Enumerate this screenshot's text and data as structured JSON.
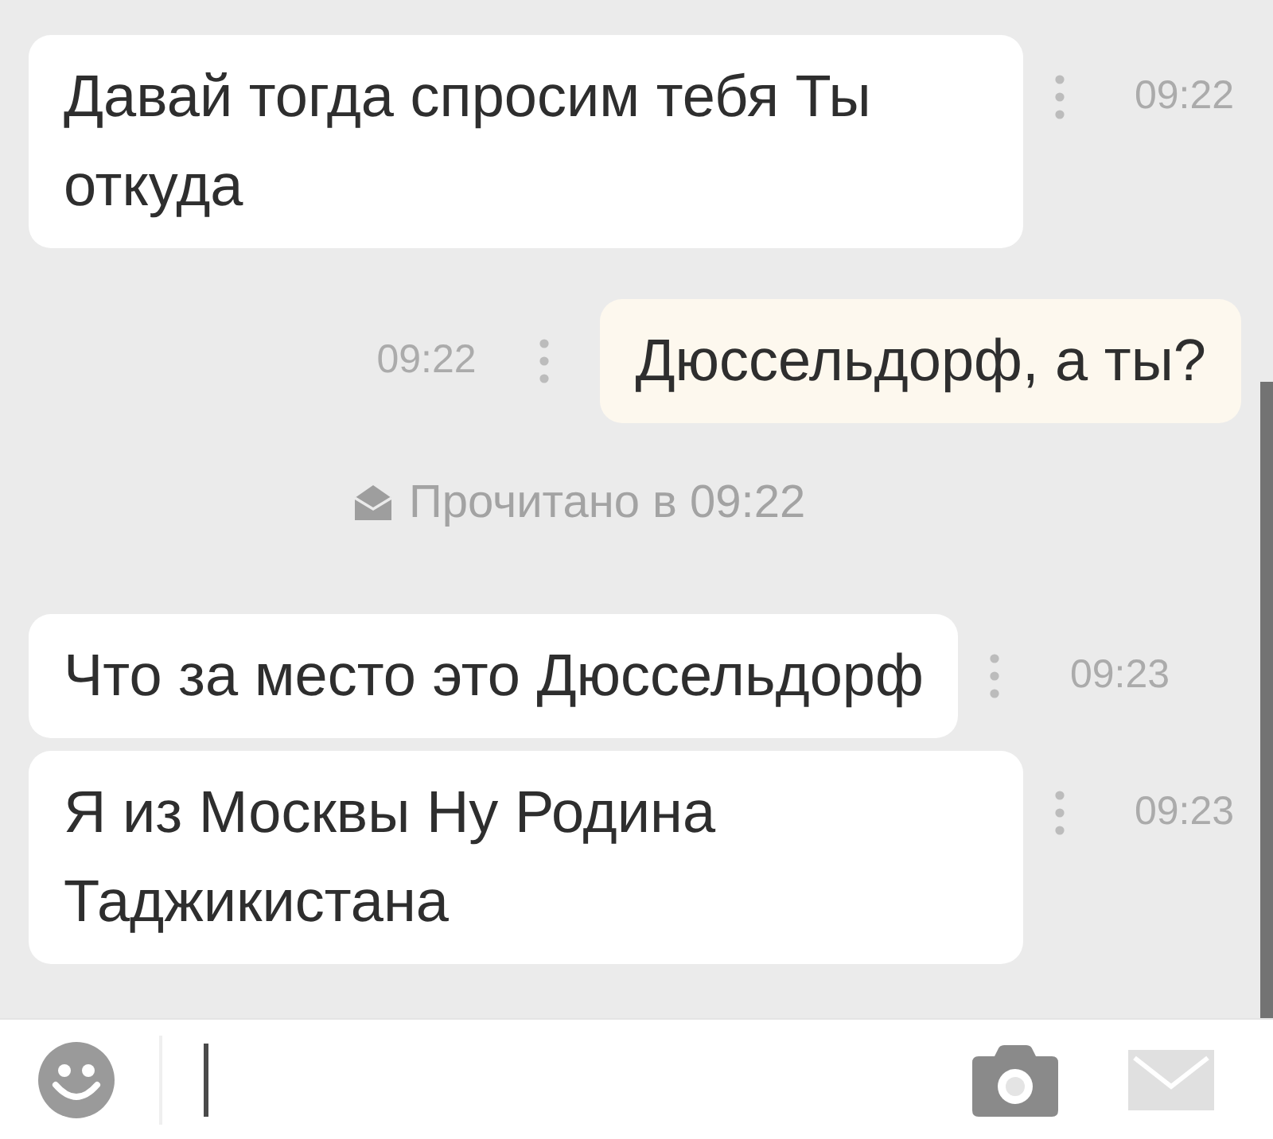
{
  "messages": [
    {
      "kind": "incoming",
      "text": "Давай тогда спросим тебя Ты откуда",
      "time": "09:22"
    },
    {
      "kind": "outgoing",
      "text": "Дюссельдорф, а ты?",
      "time": "09:22"
    },
    {
      "kind": "read_receipt",
      "text": "Прочитано в 09:22"
    },
    {
      "kind": "incoming",
      "text": "Что за место это Дюссельдорф",
      "time": "09:23"
    },
    {
      "kind": "incoming",
      "text": "Я из Москвы Ну Родина Таджикистана",
      "time": "09:23"
    }
  ],
  "composer": {
    "focused": true,
    "send_enabled": false
  }
}
